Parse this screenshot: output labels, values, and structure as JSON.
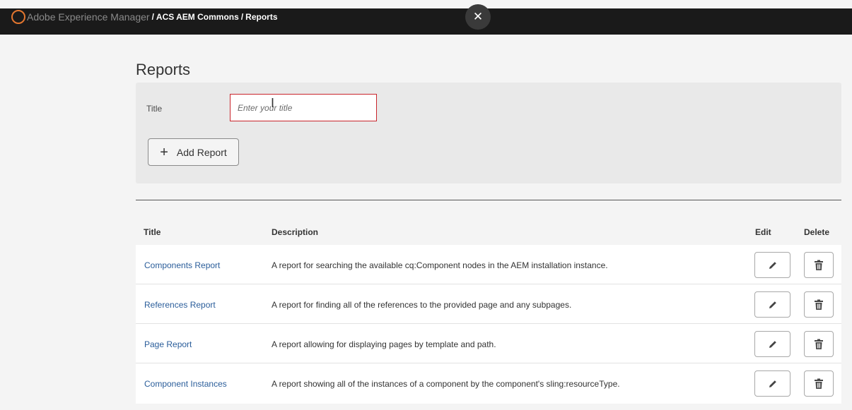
{
  "topbar": {
    "brand": "Adobe Experience Manager",
    "separator": "/",
    "breadcrumb": [
      "ACS AEM Commons",
      "Reports"
    ],
    "close_label": "✕"
  },
  "page": {
    "title": "Reports"
  },
  "form": {
    "title_label": "Title",
    "title_placeholder": "Enter your title",
    "title_value": "",
    "add_button_label": "Add Report",
    "add_button_icon": "plus-icon"
  },
  "table": {
    "headers": {
      "title": "Title",
      "description": "Description",
      "edit": "Edit",
      "delete": "Delete"
    },
    "rows": [
      {
        "title": "Components Report",
        "description": "A report for searching the available cq:Component nodes in the AEM installation instance."
      },
      {
        "title": "References Report",
        "description": "A report for finding all of the references to the provided page and any subpages."
      },
      {
        "title": "Page Report",
        "description": "A report allowing for displaying pages by template and path."
      },
      {
        "title": "Component Instances",
        "description": "A report showing all of the instances of a component by the component's sling:resourceType."
      }
    ],
    "edit_icon": "pencil-icon",
    "delete_icon": "trash-icon"
  },
  "colors": {
    "topbar_bg": "#1a1a1a",
    "link": "#2a5d9a",
    "input_border_error": "#c9252c",
    "brand_accent": "#e3762f"
  }
}
